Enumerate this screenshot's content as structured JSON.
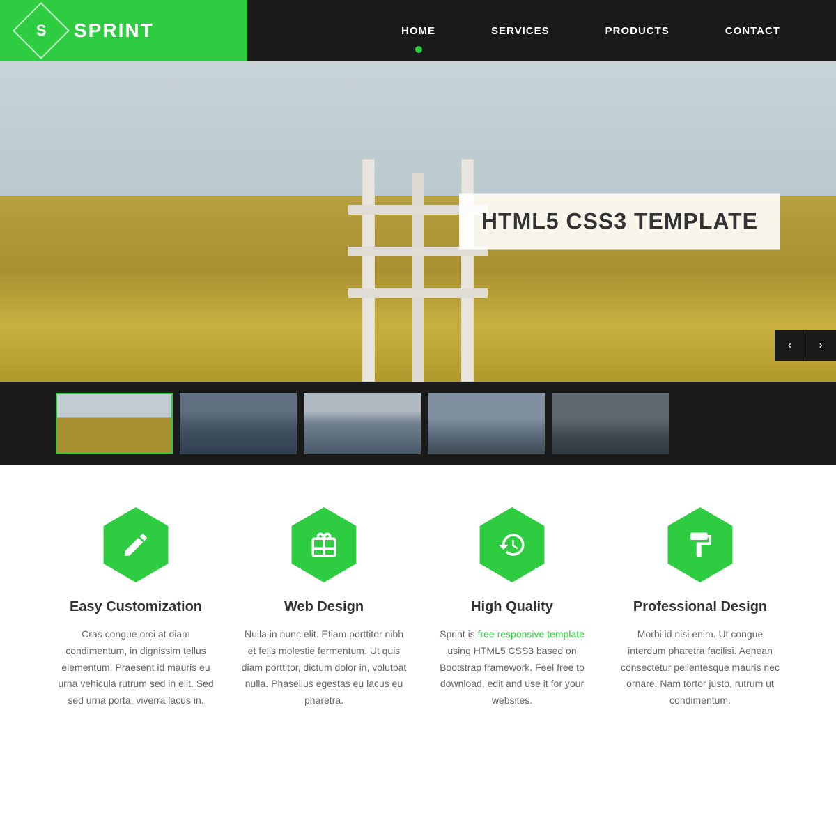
{
  "brand": {
    "letter": "S",
    "name": "SPRINT"
  },
  "nav": {
    "items": [
      {
        "label": "HOME",
        "active": true
      },
      {
        "label": "SERVICES",
        "active": false
      },
      {
        "label": "PRODUCTS",
        "active": false
      },
      {
        "label": "CONTACT",
        "active": false
      }
    ]
  },
  "hero": {
    "title": "HTML5 CSS3 TEMPLATE",
    "prev_label": "‹",
    "next_label": "›"
  },
  "features": [
    {
      "icon": "pencil",
      "title": "Easy Customization",
      "text": "Cras congue orci at diam condimentum, in dignissim tellus elementum. Praesent id mauris eu urna vehicula rutrum sed in elit. Sed sed urna porta, viverra lacus in."
    },
    {
      "icon": "gift",
      "title": "Web Design",
      "text": "Nulla in nunc elit. Etiam porttitor nibh et felis molestie fermentum. Ut quis diam porttitor, dictum dolor in, volutpat nulla. Phasellus egestas eu lacus eu pharetra."
    },
    {
      "icon": "history",
      "title": "High Quality",
      "text_before": "Sprint is ",
      "link_text": "free responsive template",
      "text_after": " using HTML5 CSS3 based on Bootstrap framework. Feel free to download, edit and use it for your websites."
    },
    {
      "icon": "paintroller",
      "title": "Professional Design",
      "text": "Morbi id nisi enim. Ut congue interdum pharetra facilisi. Aenean consectetur pellentesque mauris nec ornare. Nam tortor justo, rutrum ut condimentum."
    }
  ]
}
